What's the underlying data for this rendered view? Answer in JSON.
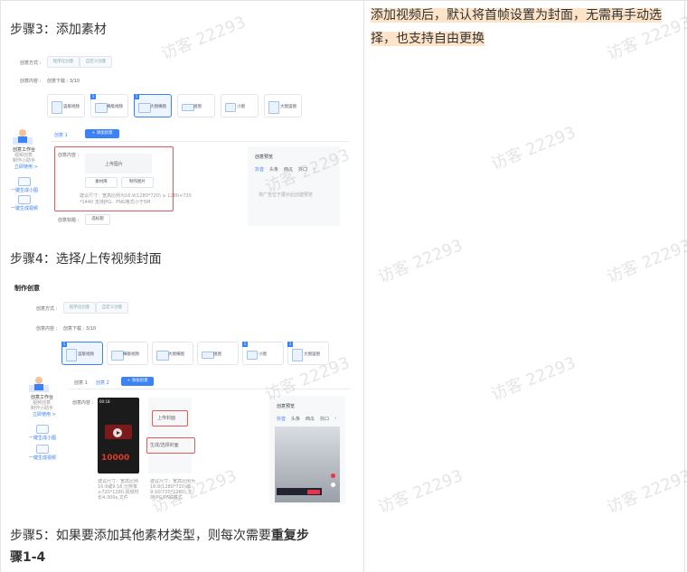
{
  "steps": {
    "step3": "步骤3：添加素材",
    "step4": "步骤4：选择/上传视频封面",
    "step5_prefix": "步骤5：如果要添加其他素材类型，则每次需要",
    "step5_bold1": "重复步",
    "step5_bold2": "骤1-4"
  },
  "note": {
    "text": "添加视频后，默认将首帧设置为封面，无需再手动选择，也支持自由更换"
  },
  "watermark": "访客 22293",
  "shot1": {
    "mode_label": "创意方式 :",
    "mode_a": "程序化创意",
    "mode_b": "自定义创意",
    "content_label": "创意内容 :",
    "content_count": "创意下载 : 3/10",
    "tiles": [
      "竖版视频",
      "横版视频",
      "大图横图",
      "组图",
      "小图",
      "大图竖图"
    ],
    "tab": "创意 1",
    "add_btn": "+ 添加创意",
    "side_title": "创意工作台",
    "side_sub1": "视频创意",
    "side_sub2": "制作小助手",
    "side_link": "立即使用 >",
    "side_item1": "一键生成小图",
    "side_item2": "一键生成视频",
    "material_label": "创意内容 :",
    "upload": "上传图片",
    "lib_btn": "素材库",
    "make_btn": "制作图片",
    "hint1": "建议尺寸：宽高比例为16:9(1280*720) ≥ 1280×720",
    "hint2": "*1440 支持JPG、PNG格式小于5M",
    "title_label": "创意标题 :",
    "title_btn": "选标题",
    "preview_title": "创意预览",
    "preview_tabs": [
      "抖音",
      "头条",
      "西瓜",
      "抖口",
      "›"
    ],
    "preview_hint": "将广告位于展示后创建预览"
  },
  "shot2": {
    "page_title": "制作创意",
    "mode_label": "创意方式 :",
    "mode_a": "程序化创意",
    "mode_b": "自定义创意",
    "content_label": "创意内容 :",
    "content_count": "创意下载 : 3/10",
    "tiles": [
      "竖版视频",
      "横版视频",
      "大图横图",
      "组图",
      "小图",
      "大图竖图"
    ],
    "tabs": [
      "创意 1",
      "创意 2"
    ],
    "add_btn": "+ 添加创意",
    "side_title": "创意工作台",
    "side_sub1": "视频创意",
    "side_sub2": "制作小助手",
    "side_link": "立即使用 >",
    "side_item1": "一键生成小图",
    "side_item2": "一键生成视频",
    "material_label": "创意内容 :",
    "video_time": "00:18",
    "video_big": "10000",
    "upload_cover": "上传封面",
    "choose_cover": "生成/选择封面",
    "hint_left": "建议尺寸：宽高比例16:9或9:16,分辨率≥720*1280,视频时长4-300s,文件≤500M,格式mp4/mov/avi",
    "hint_right": "建议尺寸：宽高比例为16:9(1280*720)或9:16(720*1280),支持JPG/PNG格式",
    "preview_title": "创意预览",
    "preview_tabs": [
      "抖音",
      "头条",
      "西瓜",
      "抖口",
      "›"
    ]
  }
}
